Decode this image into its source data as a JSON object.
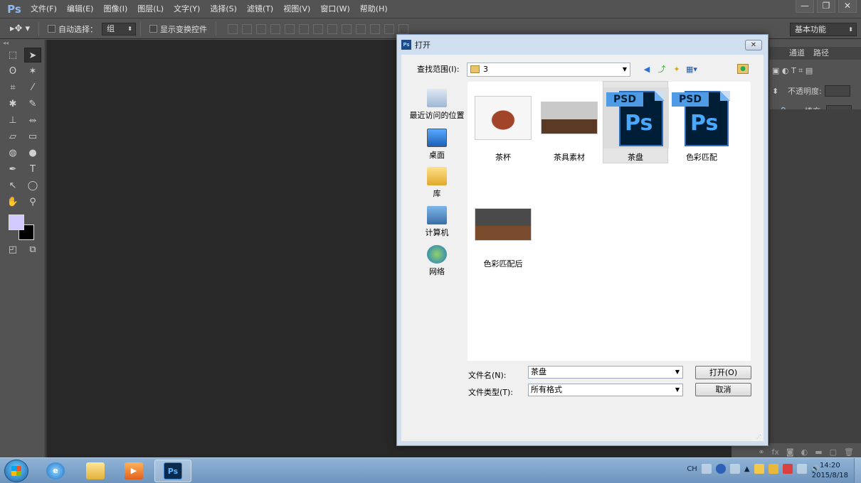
{
  "app": {
    "logo": "Ps"
  },
  "menu": [
    "文件(F)",
    "编辑(E)",
    "图像(I)",
    "图层(L)",
    "文字(Y)",
    "选择(S)",
    "滤镜(T)",
    "视图(V)",
    "窗口(W)",
    "帮助(H)"
  ],
  "window_controls": [
    "—",
    "❐",
    "✕"
  ],
  "options_bar": {
    "tool_icon": "move-tool-icon",
    "auto_select_label": "自动选择：",
    "auto_select_value": "组",
    "show_transform_label": "显示变换控件",
    "workspace_value": "基本功能"
  },
  "tools": {
    "rows": [
      [
        "⬚",
        "➤"
      ],
      [
        "ʘ",
        "✶"
      ],
      [
        "⌗",
        "⁄"
      ],
      [
        "✱",
        "✎"
      ],
      [
        "⊥",
        "⥈"
      ],
      [
        "▱",
        "▭"
      ],
      [
        "◍",
        "●"
      ],
      [
        "✒",
        "T"
      ],
      [
        "↖",
        "◯"
      ],
      [
        "✋",
        "⚲"
      ]
    ],
    "foreground_color": "#d2c9ff",
    "background_color": "#000000"
  },
  "right_panel": {
    "tabs": [
      "通道",
      "路径"
    ],
    "opacity_label": "不透明度:",
    "fill_label": "填充:"
  },
  "dialog": {
    "title": "打开",
    "close": "✕",
    "look_in_label": "查找范围(I):",
    "look_in_value": "3",
    "places": [
      "最近访问的位置",
      "桌面",
      "库",
      "计算机",
      "网络"
    ],
    "files": [
      {
        "name": "茶杯",
        "kind": "photo-cup"
      },
      {
        "name": "茶具素材",
        "kind": "photo-tea"
      },
      {
        "name": "茶盘",
        "kind": "psd",
        "selected": true
      },
      {
        "name": "色彩匹配",
        "kind": "psd"
      },
      {
        "name": "色彩匹配后",
        "kind": "photo-tea"
      }
    ],
    "psd_tag": "PSD",
    "psd_letters": "Ps",
    "filename_label": "文件名(N):",
    "filename_value": "茶盘",
    "filetype_label": "文件类型(T):",
    "filetype_value": "所有格式",
    "open_button": "打开(O)",
    "cancel_button": "取消"
  },
  "taskbar": {
    "apps": [
      "ie",
      "explorer",
      "media-player",
      "photoshop"
    ],
    "ps_label": "Ps",
    "lang": "CH",
    "time": "14:20",
    "date": "2015/8/18"
  }
}
